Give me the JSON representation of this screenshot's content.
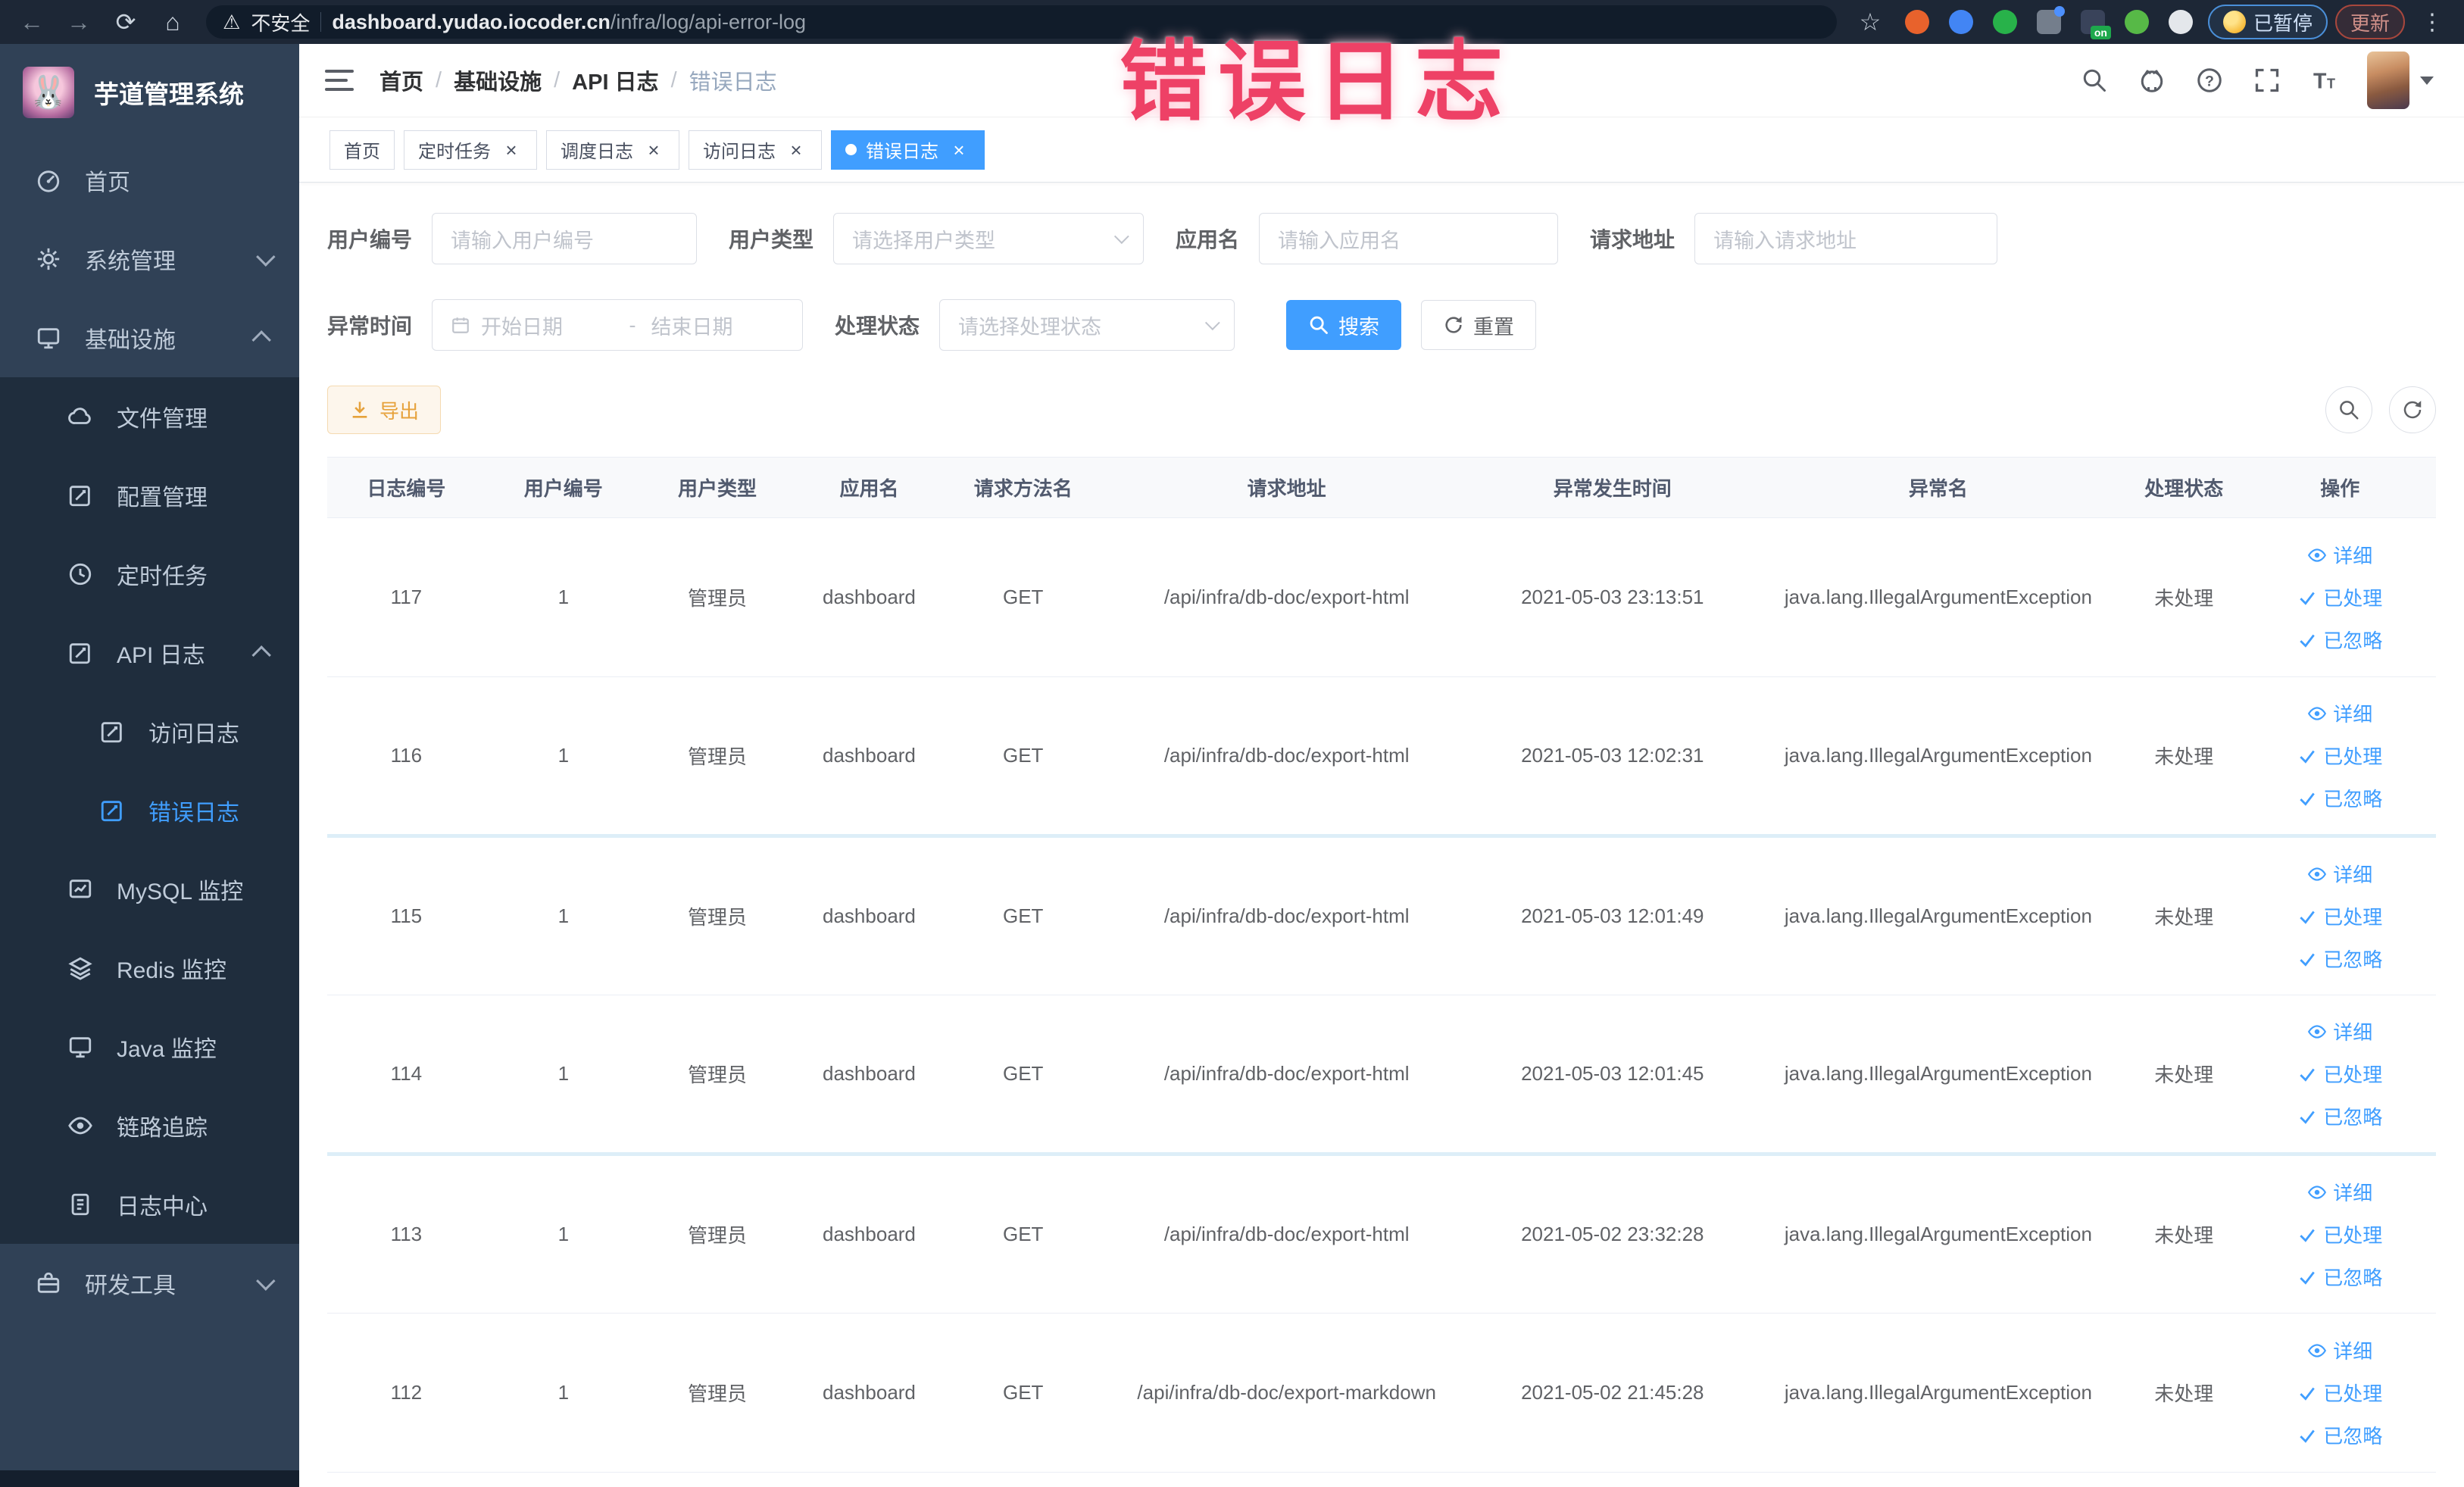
{
  "annotation": {
    "text": "错误日志"
  },
  "colors": {
    "accent": "#409EFF",
    "sidebar_bg": "#304156",
    "submenu_bg": "#1f2d3d",
    "warning": "#E6A23C",
    "annotation": "#ee4166",
    "browser_bar_bg": "#1d2736"
  },
  "browser": {
    "security_label": "不安全",
    "url_domain": "dashboard.yudao.iocoder.cn",
    "url_path": "/infra/log/api-error-log",
    "paused_chip": "已暂停",
    "update_chip": "更新",
    "icons": [
      "back-icon",
      "forward-icon",
      "reload-icon",
      "home-icon",
      "warning-triangle-icon",
      "bookmark-star-icon",
      "browser-menu-icon"
    ],
    "extensions": [
      {
        "name": "orange-ring-extension-icon",
        "shape": "circle",
        "color": "#e8622c"
      },
      {
        "name": "blue-shield-extension-icon",
        "shape": "circle",
        "color": "#4285f4"
      },
      {
        "name": "green-circle-extension-icon",
        "shape": "circle",
        "color": "#28b24a"
      },
      {
        "name": "grid-extension-icon",
        "shape": "square",
        "color": "#747e8c",
        "dot_badge": "#4d90fe"
      },
      {
        "name": "proxy-switch-extension-icon",
        "shape": "square",
        "color": "#39435a",
        "badge_text": "on",
        "badge_color": "#1ea84c"
      },
      {
        "name": "green-leaf-extension-icon",
        "shape": "circle",
        "color": "#57b947"
      },
      {
        "name": "puzzle-extension-icon",
        "shape": "circle",
        "color": "#e4e7eb"
      }
    ]
  },
  "sidebar": {
    "title": "芋道管理系统",
    "logo_icon": "rabbit-logo",
    "items": [
      {
        "key": "home",
        "label": "首页",
        "icon": "gauge-icon",
        "level": 0,
        "sub": false
      },
      {
        "key": "system-management",
        "label": "系统管理",
        "icon": "gear-icon",
        "level": 0,
        "sub": false,
        "chevron": "down"
      },
      {
        "key": "infrastructure",
        "label": "基础设施",
        "icon": "monitor-icon",
        "level": 0,
        "sub": false,
        "chevron": "up"
      },
      {
        "key": "file-management",
        "label": "文件管理",
        "icon": "cloud-icon",
        "level": 1,
        "sub": true
      },
      {
        "key": "config-management",
        "label": "配置管理",
        "icon": "edit-icon",
        "level": 1,
        "sub": true
      },
      {
        "key": "scheduled-tasks",
        "label": "定时任务",
        "icon": "clock-icon",
        "level": 1,
        "sub": true
      },
      {
        "key": "api-log",
        "label": "API 日志",
        "icon": "edit-icon",
        "level": 1,
        "sub": true,
        "chevron": "up"
      },
      {
        "key": "access-log",
        "label": "访问日志",
        "icon": "edit-icon",
        "level": 2,
        "sub": true
      },
      {
        "key": "error-log",
        "label": "错误日志",
        "icon": "edit-icon",
        "level": 2,
        "sub": true,
        "active": true
      },
      {
        "key": "mysql-monitor",
        "label": "MySQL 监控",
        "icon": "chart-icon",
        "level": 1,
        "sub": true
      },
      {
        "key": "redis-monitor",
        "label": "Redis 监控",
        "icon": "stack-icon",
        "level": 1,
        "sub": true
      },
      {
        "key": "java-monitor",
        "label": "Java 监控",
        "icon": "monitor-icon",
        "level": 1,
        "sub": true
      },
      {
        "key": "trace",
        "label": "链路追踪",
        "icon": "eye-icon",
        "level": 1,
        "sub": true
      },
      {
        "key": "log-center",
        "label": "日志中心",
        "icon": "doc-icon",
        "level": 1,
        "sub": true
      },
      {
        "key": "dev-tools",
        "label": "研发工具",
        "icon": "briefcase-icon",
        "level": 0,
        "sub": false,
        "chevron": "down"
      }
    ]
  },
  "navbar": {
    "breadcrumbs": [
      "首页",
      "基础设施",
      "API 日志",
      "错误日志"
    ],
    "right_icons": [
      "search-icon",
      "github-icon",
      "help-icon",
      "fullscreen-icon",
      "font-size-icon"
    ]
  },
  "tags": [
    {
      "key": "home",
      "label": "首页",
      "closable": false,
      "active": false
    },
    {
      "key": "scheduled-tasks",
      "label": "定时任务",
      "closable": true,
      "active": false
    },
    {
      "key": "schedule-log",
      "label": "调度日志",
      "closable": true,
      "active": false
    },
    {
      "key": "access-log",
      "label": "访问日志",
      "closable": true,
      "active": false
    },
    {
      "key": "error-log",
      "label": "错误日志",
      "closable": true,
      "active": true
    }
  ],
  "filters": {
    "user_id": {
      "label": "用户编号",
      "placeholder": "请输入用户编号"
    },
    "user_type": {
      "label": "用户类型",
      "placeholder": "请选择用户类型"
    },
    "app_name": {
      "label": "应用名",
      "placeholder": "请输入应用名"
    },
    "request_url": {
      "label": "请求地址",
      "placeholder": "请输入请求地址"
    },
    "exception_time": {
      "label": "异常时间",
      "start_placeholder": "开始日期",
      "separator": "-",
      "end_placeholder": "结束日期"
    },
    "process_status": {
      "label": "处理状态",
      "placeholder": "请选择处理状态"
    },
    "search_button": "搜索",
    "reset_button": "重置"
  },
  "toolbar": {
    "export_button": "导出",
    "icon_buttons": [
      "search-toggle-icon",
      "refresh-icon"
    ]
  },
  "table": {
    "headers": [
      "日志编号",
      "用户编号",
      "用户类型",
      "应用名",
      "请求方法名",
      "请求地址",
      "异常发生时间",
      "异常名",
      "处理状态",
      "操作"
    ],
    "row_actions": [
      {
        "key": "detail",
        "label": "详细",
        "icon": "eye-icon"
      },
      {
        "key": "processed",
        "label": "已处理",
        "icon": "check-icon"
      },
      {
        "key": "ignored",
        "label": "已忽略",
        "icon": "check-icon"
      }
    ],
    "rows": [
      [
        "117",
        "1",
        "管理员",
        "dashboard",
        "GET",
        "/api/infra/db-doc/export-html",
        "2021-05-03 23:13:51",
        "java.lang.IllegalArgumentException",
        "未处理"
      ],
      [
        "116",
        "1",
        "管理员",
        "dashboard",
        "GET",
        "/api/infra/db-doc/export-html",
        "2021-05-03 12:02:31",
        "java.lang.IllegalArgumentException",
        "未处理"
      ],
      [
        "115",
        "1",
        "管理员",
        "dashboard",
        "GET",
        "/api/infra/db-doc/export-html",
        "2021-05-03 12:01:49",
        "java.lang.IllegalArgumentException",
        "未处理"
      ],
      [
        "114",
        "1",
        "管理员",
        "dashboard",
        "GET",
        "/api/infra/db-doc/export-html",
        "2021-05-03 12:01:45",
        "java.lang.IllegalArgumentException",
        "未处理"
      ],
      [
        "113",
        "1",
        "管理员",
        "dashboard",
        "GET",
        "/api/infra/db-doc/export-html",
        "2021-05-02 23:32:28",
        "java.lang.IllegalArgumentException",
        "未处理"
      ],
      [
        "112",
        "1",
        "管理员",
        "dashboard",
        "GET",
        "/api/infra/db-doc/export-markdown",
        "2021-05-02 21:45:28",
        "java.lang.IllegalArgumentException",
        "未处理"
      ]
    ]
  }
}
